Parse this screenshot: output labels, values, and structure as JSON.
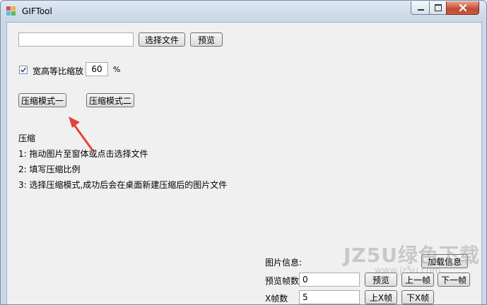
{
  "window": {
    "title": "GIFTool",
    "controls": {
      "minimize": "—",
      "maximize": "□",
      "close": "✕"
    }
  },
  "file_row": {
    "path_value": "",
    "select_file_label": "选择文件",
    "preview_label": "预览"
  },
  "scale_row": {
    "keep_ratio_checked": true,
    "keep_ratio_label": "宽高等比缩放",
    "scale_value": "60",
    "percent_label": "%"
  },
  "modes": {
    "mode1_label": "压缩模式一",
    "mode2_label": "压缩模式二"
  },
  "instructions": {
    "heading": "压缩",
    "step1": "1: 拖动图片至窗体或点击选择文件",
    "step2": "2: 填写压缩比例",
    "step3": "3: 选择压缩模式,成功后会在桌面新建压缩后的图片文件"
  },
  "image_info": {
    "label": "图片信息:",
    "load_info_label": "加载信息",
    "preview_frames_label": "预览帧数",
    "preview_frames_value": "0",
    "preview_label": "预览",
    "prev_frame_label": "上一帧",
    "next_frame_label": "下一帧",
    "x_frames_label": "X帧数",
    "x_frames_value": "5",
    "up_x_label": "上X帧",
    "down_x_label": "下X帧"
  },
  "watermark": {
    "brand": "JZ5U绿色下载",
    "url": "www.jz5u.com"
  },
  "colors": {
    "arrow": "#e8413a",
    "check": "#2b5797"
  }
}
